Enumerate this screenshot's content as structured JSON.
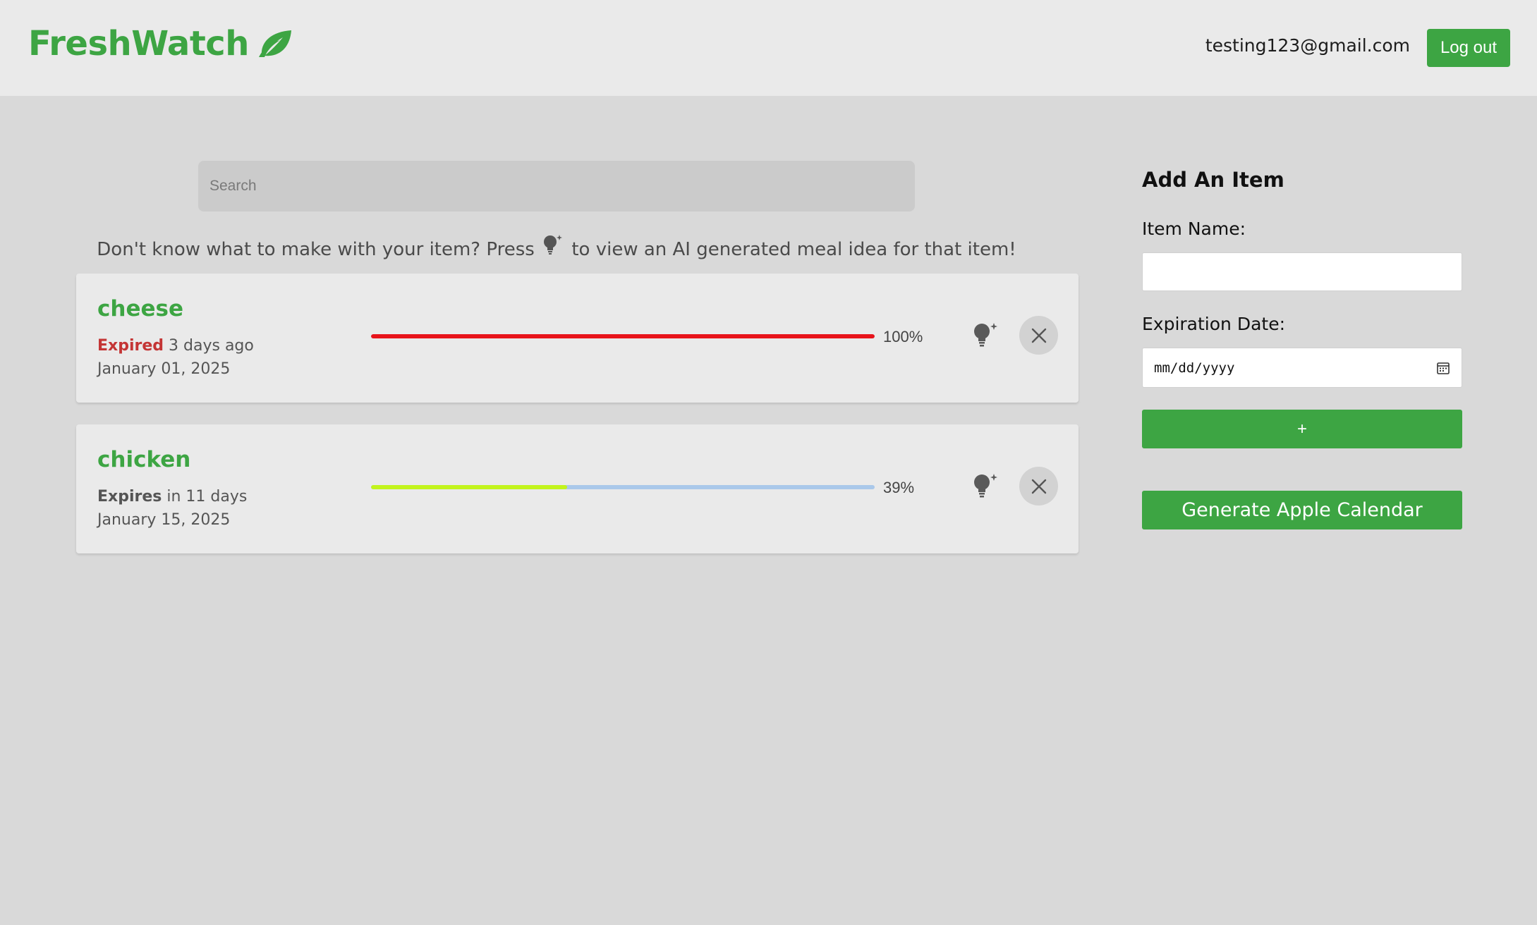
{
  "header": {
    "logo_text": "FreshWatch",
    "logo_icon": "leaf-icon",
    "user_email": "testing123@gmail.com",
    "logout_label": "Log out"
  },
  "search": {
    "placeholder": "Search"
  },
  "hint": {
    "before": "Don't know what to make with your item? Press",
    "icon": "lightbulb-sparkle-icon",
    "after": "to view an AI generated meal idea for that item!"
  },
  "items": [
    {
      "name": "cheese",
      "status_word": "Expired",
      "status_rest": "3 days ago",
      "date": "January 01, 2025",
      "progress_label": "100%",
      "progress_value": 100,
      "bar_color": "#e8141b"
    },
    {
      "name": "chicken",
      "status_word": "Expires",
      "status_rest": "in 11 days",
      "date": "January 15, 2025",
      "progress_label": "39%",
      "progress_value": 39,
      "bar_color": "#c2f41c"
    }
  ],
  "add_item": {
    "title": "Add An Item",
    "name_label": "Item Name:",
    "name_value": "",
    "date_label": "Expiration Date:",
    "date_placeholder": "mm/dd/yyyy",
    "add_button_label": "+",
    "calendar_button_label": "Generate Apple Calendar"
  },
  "colors": {
    "accent": "#3da543",
    "expired": "#c43535",
    "track": "#aac8ea"
  }
}
